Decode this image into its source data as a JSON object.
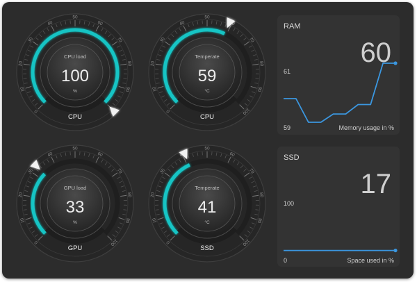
{
  "colors": {
    "accent": "#19c4c4",
    "line": "#3b97e0",
    "background": "#2c2c2c",
    "card": "#333333"
  },
  "gauges": [
    {
      "id": "cpu",
      "title": "CPU load",
      "value": "100",
      "unit": "%",
      "label": "CPU",
      "fill_fraction": 1.0,
      "ticks": [
        "0",
        "10",
        "20",
        "30",
        "40",
        "50",
        "60",
        "70",
        "80",
        "90",
        "100"
      ],
      "pointer_icon": "triangle-pointer-icon"
    },
    {
      "id": "temp",
      "title": "Temperate",
      "value": "59",
      "unit": "°C",
      "label": "CPU",
      "fill_fraction": 0.59,
      "ticks": [
        "0",
        "10",
        "20",
        "30",
        "40",
        "50",
        "60",
        "70",
        "80",
        "90",
        "100"
      ],
      "pointer_icon": "triangle-pointer-icon"
    },
    {
      "id": "gpu",
      "title": "GPU load",
      "value": "33",
      "unit": "%",
      "label": "GPU",
      "fill_fraction": 0.33,
      "ticks": [
        "0",
        "10",
        "20",
        "30",
        "40",
        "50",
        "60",
        "70",
        "80",
        "90",
        "100"
      ],
      "pointer_icon": "triangle-pointer-icon"
    },
    {
      "id": "ssd",
      "title": "Temperate",
      "value": "41",
      "unit": "°C",
      "label": "SSD",
      "fill_fraction": 0.41,
      "ticks": [
        "0",
        "10",
        "20",
        "30",
        "40",
        "50",
        "60",
        "70",
        "80",
        "90",
        "100"
      ],
      "pointer_icon": "triangle-pointer-icon"
    }
  ],
  "ram": {
    "title": "RAM",
    "value": "60",
    "y_top": "61",
    "y_bottom": "59",
    "caption": "Memory usage in %",
    "chart_data": {
      "type": "line",
      "x": [
        0,
        1,
        2,
        3,
        4,
        5,
        6,
        7,
        8,
        9
      ],
      "values": [
        60.0,
        60.0,
        59.0,
        59.0,
        59.35,
        59.35,
        59.75,
        59.75,
        61.5,
        61.5
      ],
      "ylim": [
        59,
        61
      ]
    }
  },
  "ssd_card": {
    "title": "SSD",
    "value": "17",
    "y_top": "100",
    "y_bottom": "0",
    "caption": "Space used in %",
    "chart_data": {
      "type": "line",
      "x": [
        0,
        1
      ],
      "values": [
        17,
        17
      ],
      "ylim": [
        0,
        100
      ]
    }
  }
}
